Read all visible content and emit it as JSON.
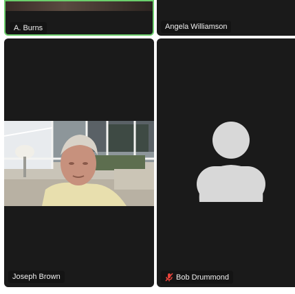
{
  "participants": [
    {
      "name": "A. Burns",
      "active_speaker": true,
      "video": "top-partial"
    },
    {
      "name": "Angela Williamson",
      "active_speaker": false,
      "video": "none"
    },
    {
      "name": "Joseph Brown",
      "active_speaker": false,
      "video": "on"
    },
    {
      "name": "Bob Drummond",
      "active_speaker": false,
      "video": "off",
      "muted": true
    }
  ],
  "colors": {
    "tile_bg": "#1a1a1a",
    "active_border": "#6ccf6c",
    "muted_icon": "#e8433a",
    "avatar": "#d8d8d8"
  }
}
